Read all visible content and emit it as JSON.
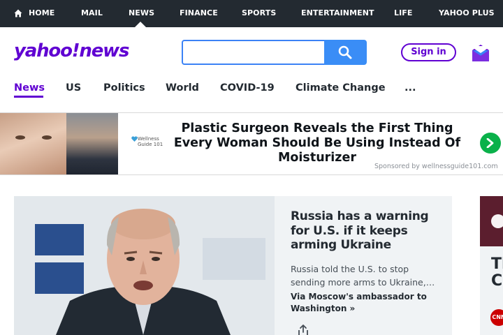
{
  "top_nav": {
    "home": "HOME",
    "mail": "MAIL",
    "news": "NEWS",
    "finance": "FINANCE",
    "sports": "SPORTS",
    "entertainment": "ENTERTAINMENT",
    "life": "LIFE",
    "plus": "YAHOO PLUS"
  },
  "header": {
    "logo": "yahoo!news",
    "search_value": "",
    "search_icon": "search-icon",
    "signin_label": "Sign in",
    "mail_icon": "mail-icon",
    "brand_color": "#6001d2"
  },
  "section_nav": {
    "items": [
      "News",
      "US",
      "Politics",
      "World",
      "COVID-19",
      "Climate Change",
      "..."
    ],
    "active": "News"
  },
  "ad": {
    "brand_line1": "Wellness",
    "brand_line2": "Guide 101",
    "headline": "Plastic Surgeon Reveals the First Thing Every Woman Should Be Using Instead Of Moisturizer",
    "sponsor": "Sponsored by wellnessguide101.com",
    "arrow_icon": "chevron-right-icon"
  },
  "story": {
    "title": "Russia has a warning for U.S. if it keeps arming Ukraine",
    "summary": "Russia told the U.S. to stop sending more arms to Ukraine,…",
    "via": "Via Moscow's ambassador to Washington »",
    "share_icon": "share-icon"
  },
  "right_card": {
    "text_line1": "Th",
    "text_line2": "Co",
    "source_logo": "CNN"
  }
}
